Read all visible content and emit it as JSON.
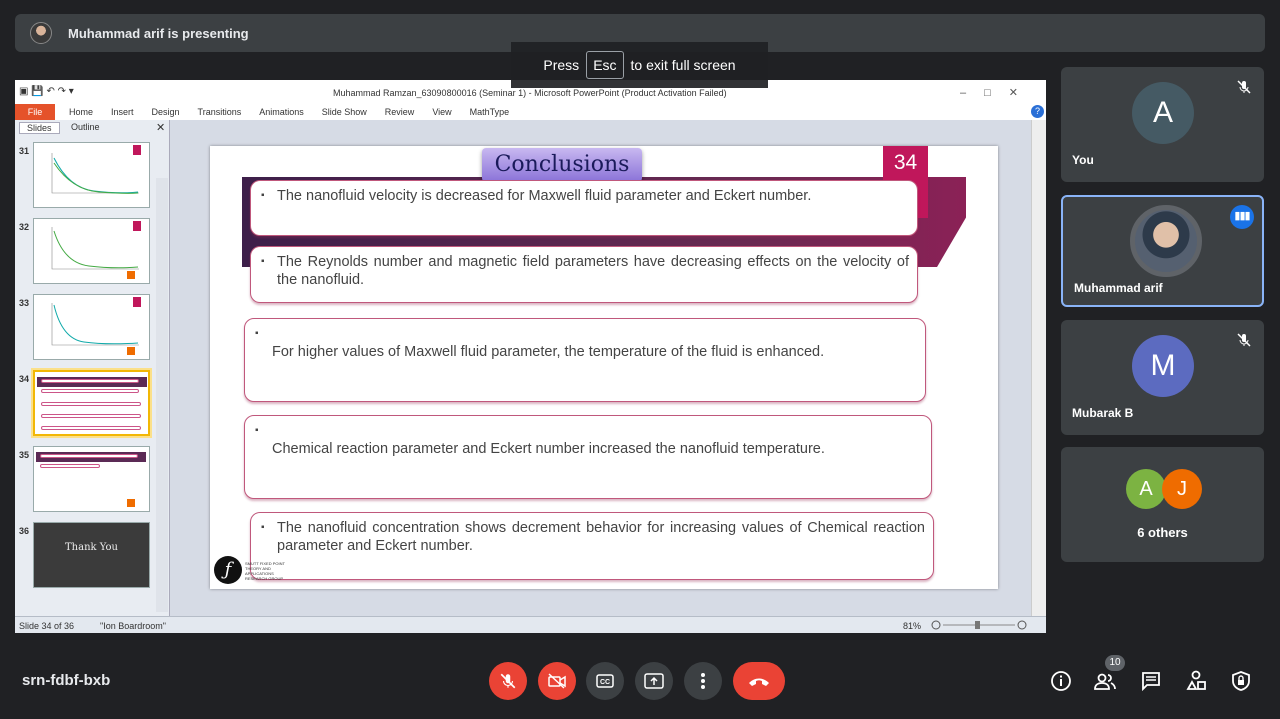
{
  "top_bar": {
    "presenting_text": "Muhammad arif is presenting"
  },
  "fullscreen_toast": {
    "press": "Press",
    "key": "Esc",
    "suffix": "to exit full screen"
  },
  "powerpoint": {
    "window_title": "Muhammad Ramzan_63090800016 (Seminar 1)  -  Microsoft PowerPoint (Product Activation Failed)",
    "ribbon_tabs": [
      "File",
      "Home",
      "Insert",
      "Design",
      "Transitions",
      "Animations",
      "Slide Show",
      "Review",
      "View",
      "MathType"
    ],
    "pane_tabs": [
      "Slides",
      "Outline"
    ],
    "thumbnails": [
      {
        "num": "31"
      },
      {
        "num": "32"
      },
      {
        "num": "33"
      },
      {
        "num": "34",
        "selected": true
      },
      {
        "num": "35"
      },
      {
        "num": "36",
        "text": "Thank You"
      }
    ],
    "status": {
      "slide": "Slide 34 of 36",
      "theme": "\"Ion Boardroom\"",
      "zoom": "81%"
    }
  },
  "slide": {
    "title": "Conclusions",
    "number": "34",
    "bullets": [
      "The nanofluid velocity is decreased for Maxwell fluid parameter and Eckert number.",
      "The Reynolds number and magnetic field parameters have decreasing effects on the velocity of the nanofluid.",
      "For higher values of Maxwell fluid parameter, the temperature of the fluid is enhanced.",
      "Chemical reaction parameter and Eckert number increased the nanofluid temperature.",
      "The nanofluid concentration shows decrement behavior for increasing values of Chemical reaction parameter and Eckert number."
    ],
    "logo_text": "SMUTT FIXED POINT THEORY AND APPLICATIONS RESEARCH GROUP"
  },
  "participants": [
    {
      "name": "You",
      "initial": "A",
      "color": "#455a64",
      "muted": true
    },
    {
      "name": "Muhammad arif",
      "speaking": true
    },
    {
      "name": "Mubarak B",
      "initial": "M",
      "color": "#5c6bc0",
      "muted": true
    },
    {
      "others_label": "6 others",
      "initials": [
        "A",
        "J"
      ],
      "colors": [
        "#7cb342",
        "#ef6c00"
      ]
    }
  ],
  "bottom": {
    "meeting_code": "srn-fdbf-bxb",
    "people_count": "10",
    "icons": [
      "mic-off-icon",
      "camera-off-icon",
      "captions-icon",
      "present-icon",
      "more-icon",
      "hang-up-icon",
      "info-icon",
      "people-icon",
      "chat-icon",
      "activities-icon",
      "host-controls-icon"
    ]
  }
}
